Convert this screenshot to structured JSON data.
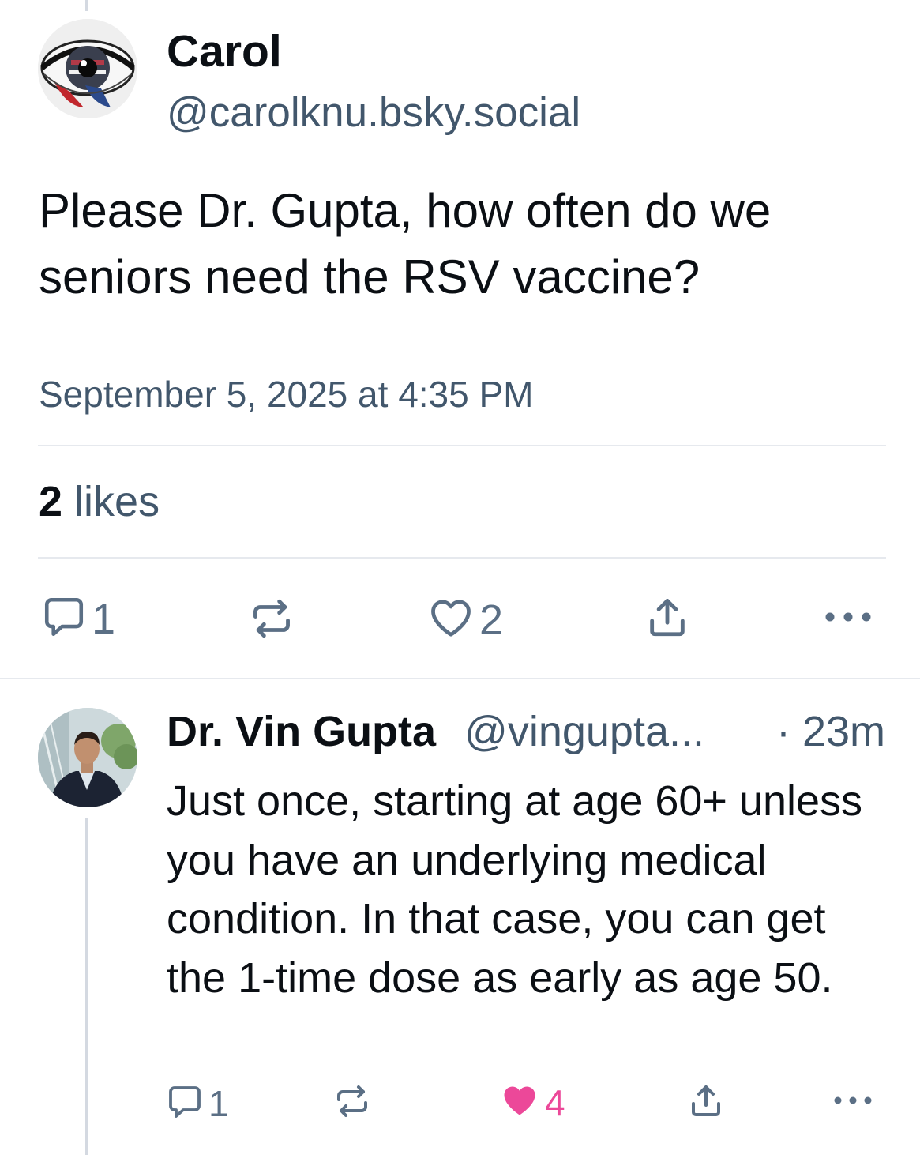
{
  "post": {
    "author_name": "Carol",
    "author_handle": "@carolknu.bsky.social",
    "text": "Please Dr. Gupta, how often do we seniors need the RSV vaccine?",
    "timestamp": "September 5, 2025 at 4:35 PM",
    "likes_count": "2",
    "likes_label": "likes",
    "actions": {
      "reply_count": "1",
      "repost_count": "",
      "like_count": "2"
    },
    "icons": [
      "reply-icon",
      "repost-icon",
      "heart-icon",
      "share-icon",
      "more-icon"
    ]
  },
  "reply": {
    "author_name": "Dr. Vin Gupta",
    "author_handle": "@vingupta...",
    "time": "· 23m",
    "text": "Just once, starting at age 60+ unless you have an underlying medical condition. In that case, you can get the 1-time dose as early as age 50.",
    "actions": {
      "reply_count": "1",
      "repost_count": "",
      "like_count": "4",
      "liked": true
    }
  },
  "colors": {
    "text_primary": "#0b0f14",
    "text_secondary": "#42576c",
    "icon_gray": "#5b6f85",
    "like_pink": "#ec4899",
    "divider": "#e6e9ee",
    "thread_line": "#d4d9e1"
  }
}
